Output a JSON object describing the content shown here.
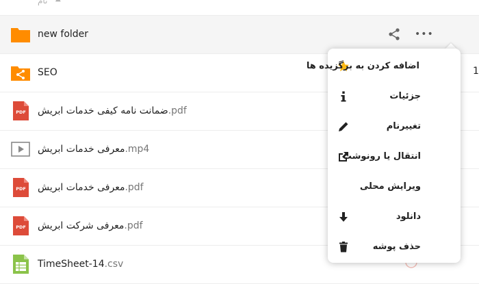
{
  "header": {
    "name_column": "نام"
  },
  "files": [
    {
      "base": "new folder",
      "ext": "",
      "type": "folder",
      "selected": true
    },
    {
      "base": "SEO",
      "ext": "",
      "type": "shared-folder",
      "selected": false
    },
    {
      "base": "ضمانت نامه کیفی خدمات ابریش",
      "ext": ".pdf",
      "type": "pdf",
      "selected": false
    },
    {
      "base": "معرفی خدمات ابریش",
      "ext": ".mp4",
      "type": "video",
      "selected": false
    },
    {
      "base": "معرفی خدمات ابریش",
      "ext": ".pdf",
      "type": "pdf",
      "selected": false
    },
    {
      "base": "معرفی شرکت ابریش",
      "ext": ".pdf",
      "type": "pdf",
      "selected": false
    },
    {
      "base": "TimeSheet-14",
      "ext": ".csv",
      "type": "spreadsheet",
      "selected": false
    }
  ],
  "pdf_badge": "PDF",
  "side_number": "1",
  "menu": {
    "items": [
      {
        "label": "اضافه کردن به برگزیده ها",
        "icon": "star-icon"
      },
      {
        "label": "جزئیات",
        "icon": "info-icon"
      },
      {
        "label": "تغییرنام",
        "icon": "pencil-icon"
      },
      {
        "label": "انتقال یا رونوشت",
        "icon": "external-link-icon"
      },
      {
        "label": "ویرایش محلی",
        "icon": ""
      },
      {
        "label": "دانلود",
        "icon": "download-icon"
      },
      {
        "label": "حذف پوشه",
        "icon": "trash-icon"
      }
    ]
  },
  "colors": {
    "folder": "#ff8c00",
    "pdf": "#dd4b39",
    "spreadsheet": "#8bc34a",
    "star": "#fdb913",
    "selected_row": "#f5f5f5"
  }
}
